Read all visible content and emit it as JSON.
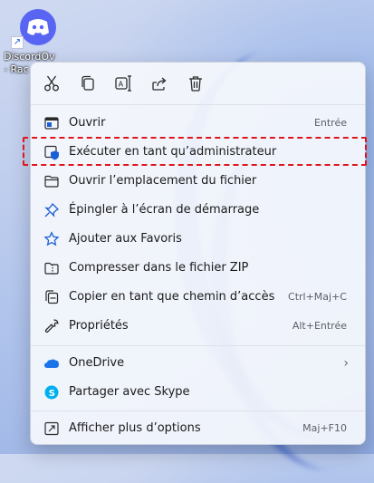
{
  "desktop": {
    "icon_name": "discord-icon",
    "label_line1": "DiscordOv",
    "label_line2": "- Rac"
  },
  "toolbar": {
    "icons": [
      "cut-icon",
      "copy-icon",
      "rename-icon",
      "share-icon",
      "delete-icon"
    ]
  },
  "menu": {
    "items": [
      {
        "label": "Ouvrir",
        "shortcut": "Entrée",
        "icon": "open-window-icon"
      },
      {
        "label": "Exécuter en tant qu’administrateur",
        "shortcut": "",
        "icon": "shield-icon"
      },
      {
        "label": "Ouvrir l’emplacement du fichier",
        "shortcut": "",
        "icon": "folder-icon"
      },
      {
        "label": "Épingler à l’écran de démarrage",
        "shortcut": "",
        "icon": "pin-icon"
      },
      {
        "label": "Ajouter aux Favoris",
        "shortcut": "",
        "icon": "star-icon"
      },
      {
        "label": "Compresser dans le fichier ZIP",
        "shortcut": "",
        "icon": "zip-icon"
      },
      {
        "label": "Copier en tant que chemin d’accès",
        "shortcut": "Ctrl+Maj+C",
        "icon": "copy-path-icon"
      },
      {
        "label": "Propriétés",
        "shortcut": "Alt+Entrée",
        "icon": "wrench-icon"
      },
      {
        "label": "OneDrive",
        "shortcut": "",
        "icon": "cloud-icon"
      },
      {
        "label": "Partager avec Skype",
        "shortcut": "",
        "icon": "skype-icon"
      },
      {
        "label": "Afficher plus d’options",
        "shortcut": "Maj+F10",
        "icon": "more-options-icon"
      }
    ]
  },
  "colors": {
    "highlight_border": "#e0141c",
    "onedrive": "#1a73e8",
    "skype": "#00aff0",
    "shield": "#1a5fd6"
  }
}
